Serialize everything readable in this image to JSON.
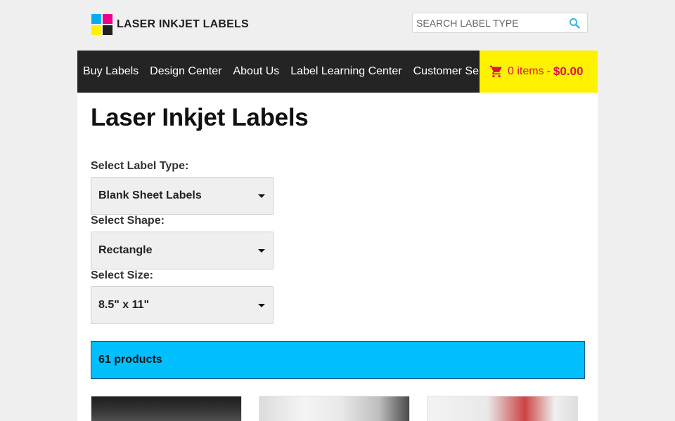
{
  "brand": {
    "name": "LASER INKJET LABELS"
  },
  "search": {
    "placeholder": "SEARCH LABEL TYPE",
    "value": ""
  },
  "nav": {
    "items": [
      {
        "label": "Buy Labels"
      },
      {
        "label": "Design Center"
      },
      {
        "label": "About Us"
      },
      {
        "label": "Label Learning Center"
      },
      {
        "label": "Customer Service"
      }
    ]
  },
  "cart": {
    "count_label": "0 items",
    "separator": "-",
    "total": "$0.00"
  },
  "page": {
    "title": "Laser Inkjet Labels"
  },
  "filters": {
    "label_type": {
      "label": "Select Label Type:",
      "value": "Blank Sheet Labels"
    },
    "shape": {
      "label": "Select Shape:",
      "value": "Rectangle"
    },
    "size": {
      "label": "Select Size:",
      "value": "8.5\" x 11\""
    }
  },
  "results": {
    "count_label": "61 products"
  },
  "colors": {
    "nav_bg": "#252424",
    "cart_bg": "#fff200",
    "cart_text": "#e0104a",
    "count_bar_bg": "#00bfff"
  }
}
